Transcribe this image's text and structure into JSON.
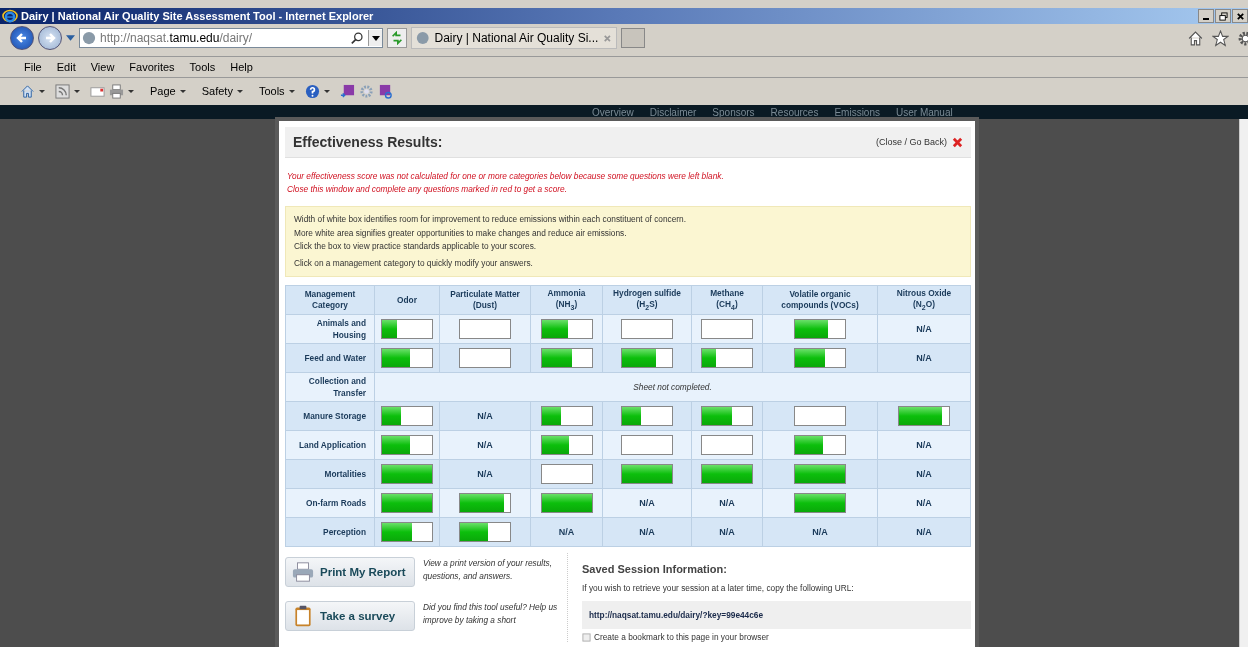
{
  "window": {
    "title": "Dairy | National Air Quality Site Assessment Tool - Internet Explorer"
  },
  "address_bar": {
    "prefix": "http://naqsat.",
    "domain": "tamu.edu",
    "path": "/dairy/"
  },
  "tab": {
    "label": "Dairy | National Air Quality Si..."
  },
  "menu": [
    "File",
    "Edit",
    "View",
    "Favorites",
    "Tools",
    "Help"
  ],
  "command_bar": [
    "Page",
    "Safety",
    "Tools"
  ],
  "site_nav": [
    "Overview",
    "Disclaimer",
    "Sponsors",
    "Resources",
    "Emissions",
    "User Manual"
  ],
  "dialog": {
    "title": "Effectiveness Results:",
    "close": "(Close / Go Back)",
    "warning": [
      "Your effectiveness score was not calculated for one or more categories below because some questions were left blank.",
      "Close this window and complete any questions marked in red to get a score."
    ],
    "info": [
      "Width of white box identifies room for improvement to reduce emissions within each constituent of concern.",
      "More white area signifies greater opportunities to make changes and reduce air emissions.",
      "Click the box to view practice standards applicable to your scores."
    ],
    "info_note": "Click on a management category to quickly modify your answers.",
    "columns": [
      {
        "name": "Management Category"
      },
      {
        "name": "Odor"
      },
      {
        "name": "Particulate Matter",
        "sub": "(Dust)"
      },
      {
        "name": "Ammonia",
        "sub": "(NH$_{3}$)"
      },
      {
        "name": "Hydrogen sulfide",
        "sub": "(H$_{2}$S)"
      },
      {
        "name": "Methane",
        "sub": "(CH$_{4}$)"
      },
      {
        "name": "Volatile organic compounds (VOCs)"
      },
      {
        "name": "Nitrous Oxide",
        "sub": "(N$_{2}$O)"
      }
    ],
    "rows": [
      {
        "category": "Animals and Housing",
        "cells": [
          {
            "kind": "bar",
            "level": 0.3
          },
          {
            "kind": "bar",
            "level": 0
          },
          {
            "kind": "bar",
            "level": 0.52
          },
          {
            "kind": "bar",
            "level": 0
          },
          {
            "kind": "bar",
            "level": 0
          },
          {
            "kind": "bar",
            "level": 0.65
          },
          {
            "kind": "text",
            "text": "N/A"
          }
        ]
      },
      {
        "category": "Feed and Water",
        "cells": [
          {
            "kind": "bar",
            "level": 0.55
          },
          {
            "kind": "bar",
            "level": 0
          },
          {
            "kind": "bar",
            "level": 0.6
          },
          {
            "kind": "bar",
            "level": 0.67
          },
          {
            "kind": "bar",
            "level": 0.27
          },
          {
            "kind": "bar",
            "level": 0.6
          },
          {
            "kind": "text",
            "text": "N/A"
          }
        ]
      },
      {
        "category": "Collection and Transfer",
        "note": "Sheet not completed."
      },
      {
        "category": "Manure Storage",
        "cells": [
          {
            "kind": "bar",
            "level": 0.38
          },
          {
            "kind": "text",
            "text": "N/A"
          },
          {
            "kind": "bar",
            "level": 0.38
          },
          {
            "kind": "bar",
            "level": 0.38
          },
          {
            "kind": "bar",
            "level": 0.6
          },
          {
            "kind": "bar",
            "level": 0
          },
          {
            "kind": "bar",
            "level": 0.86
          }
        ]
      },
      {
        "category": "Land Application",
        "cells": [
          {
            "kind": "bar",
            "level": 0.55
          },
          {
            "kind": "text",
            "text": "N/A"
          },
          {
            "kind": "bar",
            "level": 0.55
          },
          {
            "kind": "bar",
            "level": 0
          },
          {
            "kind": "bar",
            "level": 0
          },
          {
            "kind": "bar",
            "level": 0.55
          },
          {
            "kind": "text",
            "text": "N/A"
          }
        ]
      },
      {
        "category": "Mortalities",
        "cells": [
          {
            "kind": "bar",
            "level": 1
          },
          {
            "kind": "text",
            "text": "N/A"
          },
          {
            "kind": "bar",
            "level": 0
          },
          {
            "kind": "bar",
            "level": 1
          },
          {
            "kind": "bar",
            "level": 1
          },
          {
            "kind": "bar",
            "level": 1
          },
          {
            "kind": "text",
            "text": "N/A"
          }
        ]
      },
      {
        "category": "On-farm Roads",
        "cells": [
          {
            "kind": "bar",
            "level": 1
          },
          {
            "kind": "bar",
            "level": 0.87
          },
          {
            "kind": "bar",
            "level": 1
          },
          {
            "kind": "text",
            "text": "N/A"
          },
          {
            "kind": "text",
            "text": "N/A"
          },
          {
            "kind": "bar",
            "level": 1
          },
          {
            "kind": "text",
            "text": "N/A"
          }
        ]
      },
      {
        "category": "Perception",
        "cells": [
          {
            "kind": "bar",
            "level": 0.6
          },
          {
            "kind": "bar",
            "level": 0.55
          },
          {
            "kind": "text",
            "text": "N/A"
          },
          {
            "kind": "text",
            "text": "N/A"
          },
          {
            "kind": "text",
            "text": "N/A"
          },
          {
            "kind": "text",
            "text": "N/A"
          },
          {
            "kind": "text",
            "text": "N/A"
          }
        ]
      }
    ],
    "actions": [
      {
        "kind": "print",
        "label": "Print My Report",
        "description": "View a print version of your results, questions, and answers."
      },
      {
        "kind": "survey",
        "label": "Take a survey",
        "description": "Did you find this tool useful? Help us improve by taking a short"
      }
    ],
    "session": {
      "title": "Saved Session Information:",
      "text": "If you wish to retrieve your session at a later time, copy the following URL:",
      "url": "http://naqsat.tamu.edu/dairy/?key=99e44c6e",
      "bookmark": "Create a bookmark to this page in your browser"
    }
  }
}
